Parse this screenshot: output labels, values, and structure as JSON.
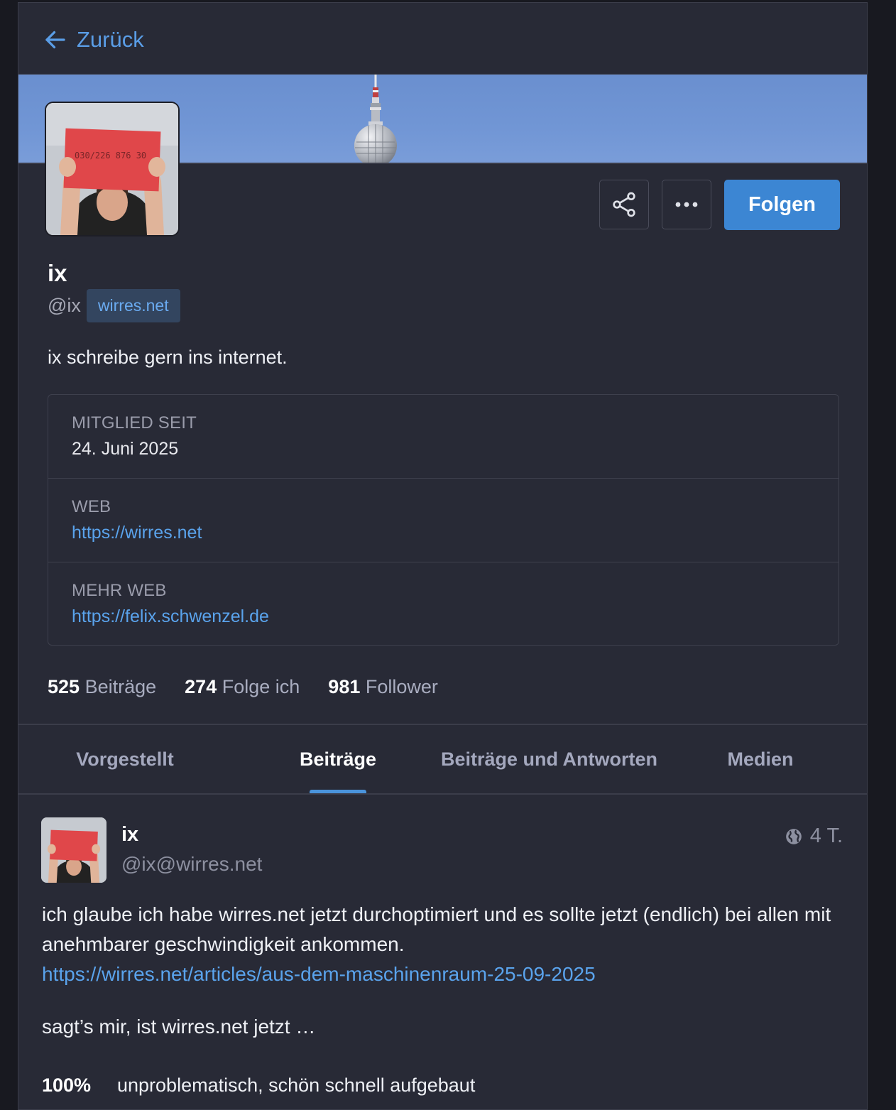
{
  "header": {
    "back_label": "Zurück"
  },
  "profile": {
    "avatar_sign_text": "030/226 876 30",
    "display_name": "ix",
    "handle": "@ix",
    "domain": "wirres.net",
    "bio": "ix schreibe gern ins internet.",
    "follow_label": "Folgen",
    "fields": [
      {
        "label": "Mitglied seit",
        "value": "24. Juni 2025"
      },
      {
        "label": "Web",
        "value": "https://wirres.net"
      },
      {
        "label": "Mehr Web",
        "value": "https://felix.schwenzel.de"
      }
    ],
    "stats": [
      {
        "count": "525",
        "label": "Beiträge"
      },
      {
        "count": "274",
        "label": "Folge ich"
      },
      {
        "count": "981",
        "label": "Follower"
      }
    ]
  },
  "tabs": [
    {
      "label": "Vorgestellt",
      "active": false
    },
    {
      "label": "Beiträge",
      "active": true
    },
    {
      "label": "Beiträge und Antworten",
      "active": false
    },
    {
      "label": "Medien",
      "active": false
    }
  ],
  "post": {
    "author_name": "ix",
    "author_handle": "@ix@wirres.net",
    "age": "4 T.",
    "text_line": "ich glaube ich habe wirres.net jetzt durchoptimiert und es sollte jetzt (endlich) bei allen mit anehmbarer geschwindigkeit ankommen.",
    "link": "https://wirres.net/articles/aus-dem-maschinenraum-25-09-2025",
    "question": "sagt’s mir, ist wirres.net jetzt …",
    "poll": [
      {
        "percent": "100%",
        "option": "unproblematisch, schön schnell aufgebaut"
      }
    ]
  },
  "colors": {
    "accent": "#3c86d3",
    "link": "#5aa3ec",
    "background": "#282a36"
  }
}
